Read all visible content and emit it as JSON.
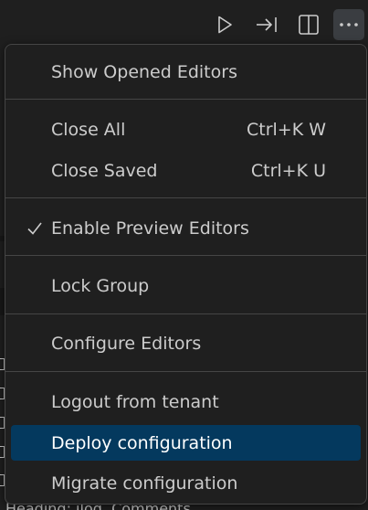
{
  "toolbar": {
    "icons": [
      "run-icon",
      "step-forward-icon",
      "split-editor-icon",
      "more-actions-icon"
    ]
  },
  "background": {
    "partial_text": "Heading: ilog. Comments..."
  },
  "menu": {
    "items": [
      {
        "label": "Show Opened Editors",
        "shortcut": ""
      },
      {
        "label": "Close All",
        "shortcut": "Ctrl+K W"
      },
      {
        "label": "Close Saved",
        "shortcut": "Ctrl+K U"
      },
      {
        "label": "Enable Preview Editors",
        "shortcut": "",
        "checked": true
      },
      {
        "label": "Lock Group",
        "shortcut": ""
      },
      {
        "label": "Configure Editors",
        "shortcut": ""
      },
      {
        "label": "Logout from tenant",
        "shortcut": ""
      },
      {
        "label": "Deploy configuration",
        "shortcut": "",
        "highlighted": true
      },
      {
        "label": "Migrate configuration",
        "shortcut": ""
      }
    ]
  },
  "colors": {
    "menu_background": "#1f1f1f",
    "menu_border": "#454545",
    "highlight": "#04395e",
    "text": "#cccccc"
  }
}
